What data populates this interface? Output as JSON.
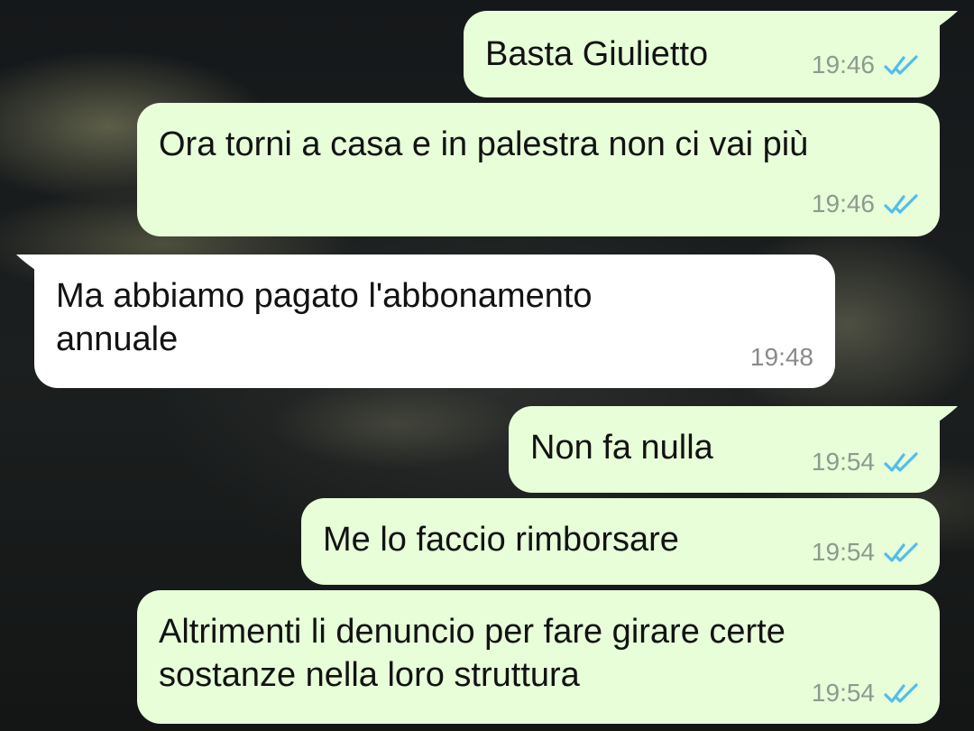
{
  "messages": [
    {
      "direction": "outgoing",
      "text": "Basta Giulietto",
      "time": "19:46",
      "status": "read"
    },
    {
      "direction": "outgoing",
      "text": "Ora torni a casa e in palestra non ci vai più",
      "time": "19:46",
      "status": "read"
    },
    {
      "direction": "incoming",
      "text": "Ma abbiamo pagato l'abbonamento\nannuale",
      "time": "19:48"
    },
    {
      "direction": "outgoing",
      "text": "Non fa nulla",
      "time": "19:54",
      "status": "read"
    },
    {
      "direction": "outgoing",
      "text": "Me lo faccio rimborsare",
      "time": "19:54",
      "status": "read"
    },
    {
      "direction": "outgoing",
      "text": "Altrimenti li denuncio per fare girare certe\nsostanze nella loro struttura",
      "time": "19:54",
      "status": "read"
    }
  ],
  "icons": {
    "read_receipt": "double-check-icon"
  },
  "colors": {
    "outgoing_bubble": "#e7fed9",
    "incoming_bubble": "#ffffff",
    "read_check": "#53bdeb",
    "timestamp": "#8e9a8e"
  }
}
